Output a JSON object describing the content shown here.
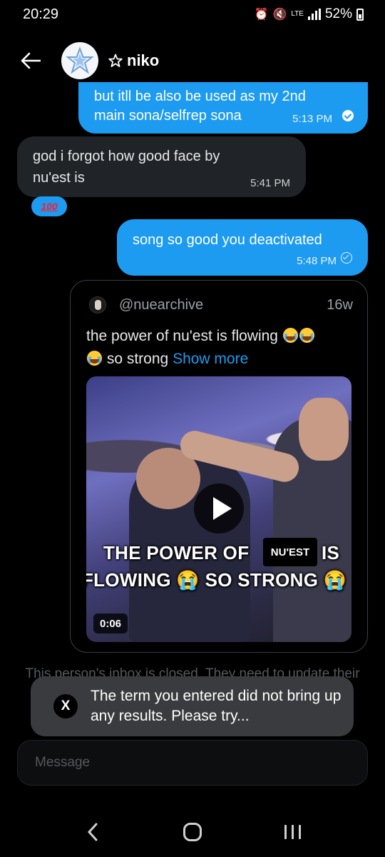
{
  "status_bar": {
    "time": "20:29",
    "network": "LTE",
    "battery": "52%"
  },
  "header": {
    "title": "niko",
    "back_icon": "arrow-left-icon",
    "verified_icon": "star-outline-icon"
  },
  "messages": [
    {
      "type": "sent",
      "line1": "but itll be also be used as my 2nd",
      "line2": "main sona/selfrep sona",
      "time": "5:13 PM",
      "status": "read"
    },
    {
      "type": "received",
      "line1": "god i forgot how good face by",
      "line2": "nu'est is",
      "time": "5:41 PM",
      "reaction": "100"
    },
    {
      "type": "sent",
      "line1": "song so good you deactivated",
      "time": "5:48 PM",
      "status": "sent"
    }
  ],
  "tweet_card": {
    "handle": "@nuearchive",
    "age": "16w",
    "text_part1": "the power of nu'est is flowing ",
    "text_part2": " so strong ",
    "show_more": "Show more",
    "video": {
      "caption_line1": "THE POWER OF",
      "caption_line1_end": "IS",
      "caption_line2": "FLOWING 😭 SO STRONG 😭",
      "overlay_label": "NU'EST",
      "duration": "0:06"
    }
  },
  "inbox_notice": "This person's inbox is closed. They need to update their message settings before you can message them.",
  "toast": {
    "logo": "X",
    "text": "The term you entered did not bring up any results. Please try..."
  },
  "composer": {
    "placeholder": "Message"
  },
  "colors": {
    "sent_bubble": "#1d9bf0",
    "received_bubble": "#202327",
    "background": "#000000",
    "link": "#1d9bf0"
  }
}
